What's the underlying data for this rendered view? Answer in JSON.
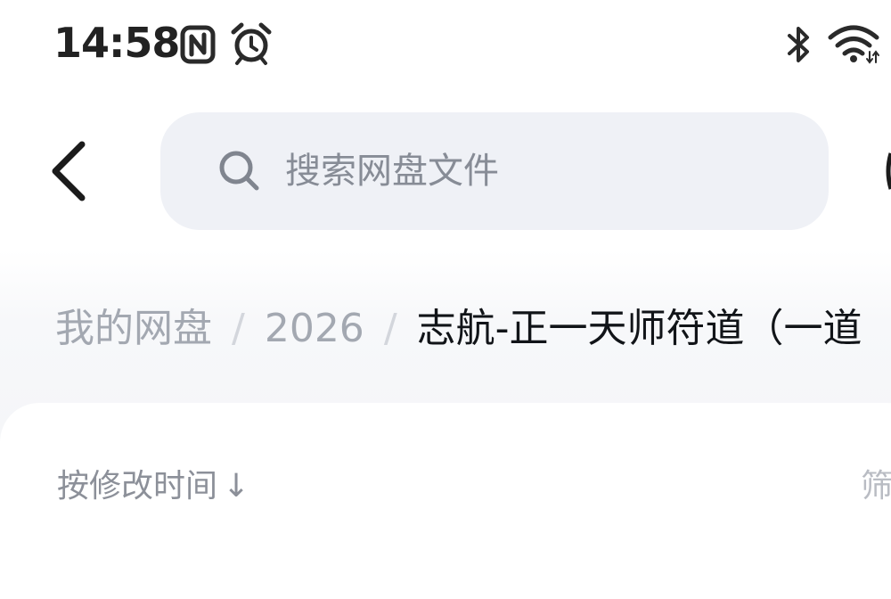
{
  "status_bar": {
    "time": "14:58",
    "icons": [
      "nfc-icon",
      "alarm-icon",
      "bluetooth-icon",
      "wifi-icon"
    ]
  },
  "header": {
    "back_icon": "chevron-left-icon",
    "search": {
      "icon": "search-icon",
      "placeholder": "搜索网盘文件"
    }
  },
  "breadcrumb": {
    "items": [
      "我的网盘",
      "2026"
    ],
    "separator": "/",
    "current": "志航-正一天师符道（一道"
  },
  "toolbar": {
    "sort_label": "按修改时间",
    "sort_arrow": "↓",
    "filter_label": "筛"
  },
  "colors": {
    "search_bg": "#eff1f6",
    "muted_text": "#a3a8b1",
    "primary_text": "#111418"
  }
}
